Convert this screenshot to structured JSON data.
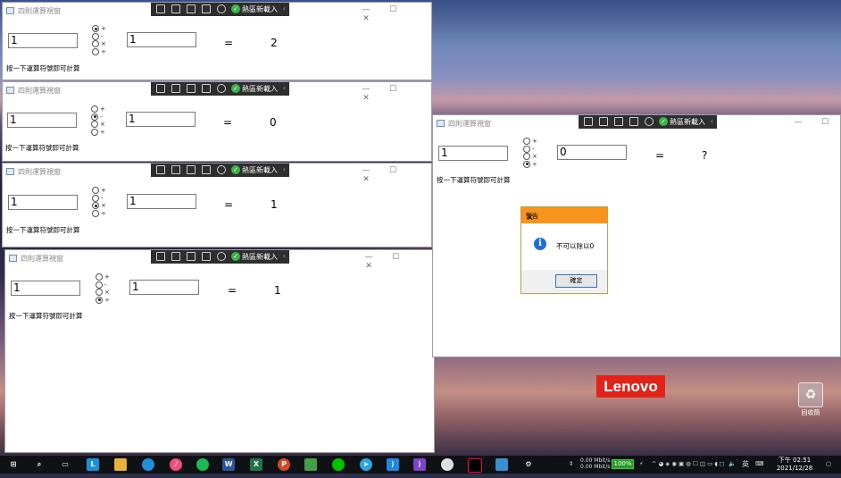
{
  "calc": {
    "title": "四則運算視窗",
    "hint": "按一下運算符號即可計算",
    "operators": [
      "+",
      "-",
      "×",
      "÷"
    ],
    "equals": "="
  },
  "capture_toolbar": {
    "label": "熱區新載入"
  },
  "windows": [
    {
      "input1": "1",
      "input2": "1",
      "result": "2",
      "selected": 0
    },
    {
      "input1": "1",
      "input2": "1",
      "result": "0",
      "selected": 1
    },
    {
      "input1": "1",
      "input2": "1",
      "result": "1",
      "selected": 2
    },
    {
      "input1": "1",
      "input2": "1",
      "result": "1",
      "selected": 3
    },
    {
      "input1": "1",
      "input2": "0",
      "result": "?",
      "selected": 3
    }
  ],
  "dialog": {
    "title": "警告",
    "message": "不可以除以0",
    "ok_label": "確定"
  },
  "desktop": {
    "brand": "Lenovo",
    "recycle_bin_label": "回收筒"
  },
  "taskbar": {
    "network_up": "0.00 Mbit/s",
    "network_down": "0.00 Mbit/s",
    "battery": "100%",
    "ime": "英",
    "time": "下午 02:51",
    "date": "2021/12/28"
  },
  "colors": {
    "dialog_title": "#f7941d",
    "brand_red": "#e2231a",
    "battery_green": "#2a9a2a"
  }
}
